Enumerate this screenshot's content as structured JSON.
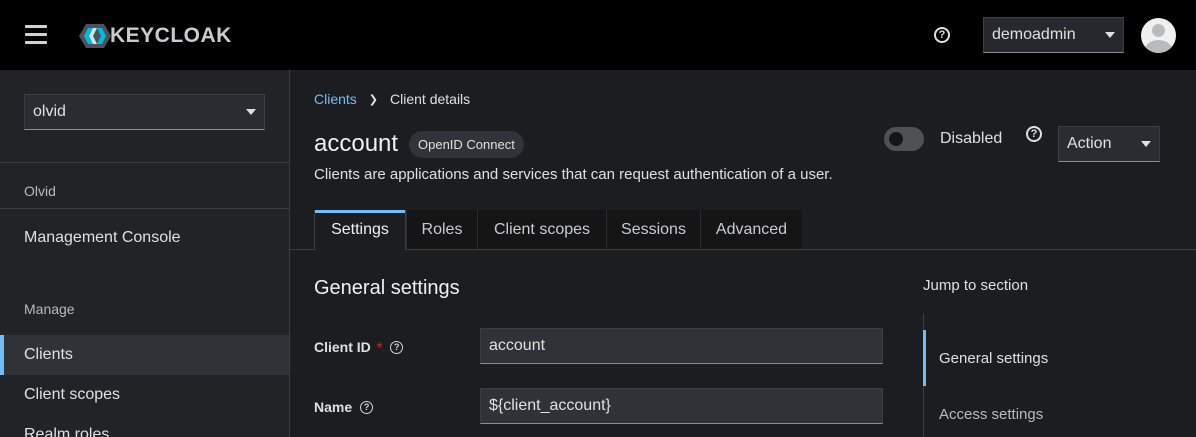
{
  "header": {
    "logo_text": "KEYCLOAK",
    "help_symbol": "?",
    "user_dropdown": "demoadmin"
  },
  "sidebar": {
    "realm": "olvid",
    "realm_label": "Olvid",
    "console_item": "Management Console",
    "section_label": "Manage",
    "items": [
      {
        "label": "Clients",
        "active": true
      },
      {
        "label": "Client scopes",
        "active": false
      },
      {
        "label": "Realm roles",
        "active": false
      }
    ]
  },
  "breadcrumb": {
    "link": "Clients",
    "current": "Client details"
  },
  "client": {
    "title": "account",
    "protocol_badge": "OpenID Connect",
    "description": "Clients are applications and services that can request authentication of a user.",
    "toggle_label": "Disabled",
    "toggle_on": false,
    "action_label": "Action"
  },
  "tabs": [
    {
      "label": "Settings",
      "active": true
    },
    {
      "label": "Roles",
      "active": false
    },
    {
      "label": "Client scopes",
      "active": false
    },
    {
      "label": "Sessions",
      "active": false
    },
    {
      "label": "Advanced",
      "active": false
    }
  ],
  "form": {
    "section_title": "General settings",
    "client_id_label": "Client ID",
    "required_mark": "*",
    "client_id_value": "account",
    "name_label": "Name",
    "name_value": "${client_account}"
  },
  "jump": {
    "title": "Jump to section",
    "items": [
      {
        "label": "General settings",
        "active": true
      },
      {
        "label": "Access settings",
        "active": false
      }
    ]
  },
  "colors": {
    "accent": "#73bcf7",
    "required": "#c9190b",
    "header_bg": "#000000",
    "page_bg": "#1b1d21"
  }
}
